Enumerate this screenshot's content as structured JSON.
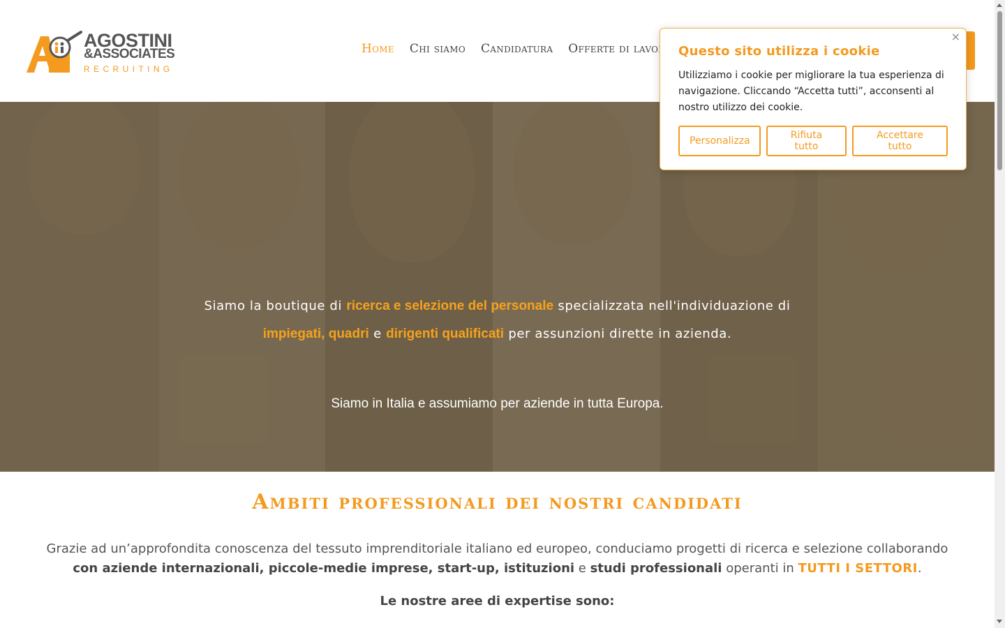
{
  "logo": {
    "main": "AGOSTINI",
    "sub": "&ASSOCIATES",
    "tagline": "RECRUITING",
    "brand_color": "#f39a1f"
  },
  "nav": {
    "items": [
      {
        "label": "Home",
        "active": true
      },
      {
        "label": "Chi siamo",
        "active": false
      },
      {
        "label": "Candidatura",
        "active": false
      },
      {
        "label": "Offerte di lavoro",
        "active": false
      }
    ]
  },
  "hero": {
    "line1_pre": "Siamo la boutique di ",
    "line1_hl": "ricerca e selezione del personale",
    "line1_post": " specializzata nell'individuazione di",
    "line2_hl1": "impiegati, quadri",
    "line2_mid": " e ",
    "line2_hl2": "dirigenti qualificati",
    "line2_post": " per assunzioni dirette in azienda.",
    "line3": "Siamo in Italia e assumiamo per aziende in tutta Europa."
  },
  "section": {
    "title": "Ambiti professionali dei nostri candidati",
    "p1": "Grazie ad un’approfondita conoscenza del tessuto imprenditoriale italiano ed europeo, conduciamo progetti di ricerca e selezione collaborando",
    "p2_b1": "con aziende internazionali, piccole-medie imprese, start-up, istituzioni",
    "p2_mid": " e ",
    "p2_b2": "studi professionali",
    "p2_mid2": " operanti in ",
    "p2_orange": "TUTTI I SETTORI",
    "p2_end": ".",
    "subtitle": "Le nostre aree di expertise sono:"
  },
  "cookie": {
    "title": "Questo sito utilizza i cookie",
    "text": "Utilizziamo i cookie per migliorare la tua esperienza di navigazione. Cliccando “Accetta tutti”, acconsenti al nostro utilizzo dei cookie.",
    "close": "×",
    "btn_customize": "Personalizza",
    "btn_reject": "Rifiuta tutto",
    "btn_accept": "Accettare tutto"
  }
}
